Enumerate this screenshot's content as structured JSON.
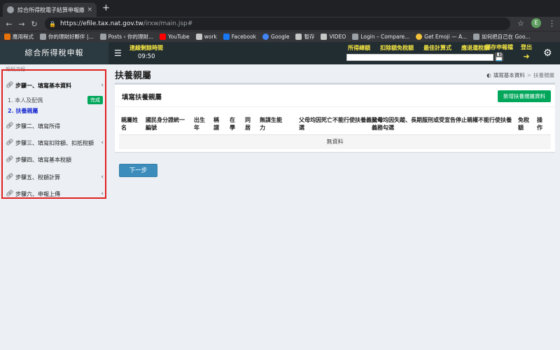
{
  "browser": {
    "tab_title": "綜合所得稅電子結算申報繳稅系",
    "tab_close": "×",
    "new_tab": "+",
    "url_host": "https://efile.tax.nat.gov.tw",
    "url_path": "/irxw/main.jsp#",
    "profile_initial": "E",
    "bookmarks": [
      {
        "label": "應用程式",
        "icon": "grid-icon"
      },
      {
        "label": "你的理財好夥伴 |...",
        "icon": "plane-icon"
      },
      {
        "label": "Posts ‹ 你的理財...",
        "icon": "page-icon"
      },
      {
        "label": "YouTube",
        "icon": "youtube-icon"
      },
      {
        "label": "work",
        "icon": "folder-icon"
      },
      {
        "label": "Facebook",
        "icon": "facebook-icon"
      },
      {
        "label": "Google",
        "icon": "google-icon"
      },
      {
        "label": "暫存",
        "icon": "folder-icon"
      },
      {
        "label": "VIDEO",
        "icon": "folder-icon"
      },
      {
        "label": "Login – Compare...",
        "icon": "page-icon"
      },
      {
        "label": "Get Emoji — A...",
        "icon": "emoji-icon"
      },
      {
        "label": "如何把自己在 Goo...",
        "icon": "send-icon"
      }
    ]
  },
  "header": {
    "app_name": "綜合所得稅申報",
    "timer_label": "連線剩餘時間",
    "timer_value": "09:50",
    "links": [
      "所得總額",
      "扣除額免稅額",
      "最佳計算式",
      "應退還稅額"
    ],
    "save_label": "儲存申報檔",
    "logout_label": "登出"
  },
  "sidebar": {
    "section_label": "報稅流程",
    "steps": [
      {
        "label": "步驟一、填寫基本資料",
        "chevron": "‹"
      },
      {
        "label": "步驟二、填寫所得",
        "chevron": ""
      },
      {
        "label": "步驟三、填寫扣除額、扣抵稅額",
        "chevron": "‹"
      },
      {
        "label": "步驟四、填寫基本稅額",
        "chevron": ""
      },
      {
        "label": "步驟五、稅額計算",
        "chevron": "‹"
      },
      {
        "label": "步驟六、申報上傳",
        "chevron": "‹"
      }
    ],
    "substeps": [
      {
        "label": "1. 本人及配偶",
        "badge": "完成"
      },
      {
        "label": "2. 扶養親屬",
        "badge": ""
      }
    ]
  },
  "main": {
    "page_title": "扶養親屬",
    "breadcrumb": {
      "home": "填寫基本資料",
      "separator": ">",
      "current": "扶養親屬"
    },
    "box_title": "填寫扶養親屬",
    "add_button": "新增扶養親屬資料",
    "table_headers": [
      "親屬姓名",
      "國民身分證統一編號",
      "出生年",
      "稱謂",
      "在學",
      "同居",
      "無謀生能力",
      "父母均因死亡不能行使扶養義務勾選",
      "父母均因失蹤、長期服刑或受宣告停止親權不能行使扶養義務勾選",
      "免稅額",
      "操作"
    ],
    "empty_text": "無資料",
    "next_button": "下一步"
  },
  "colors": {
    "header_bg": "#222d32",
    "highlight_yellow": "#f5e642",
    "success_green": "#00a65a",
    "primary_blue": "#3c8dbc",
    "annotation_red": "#e02020"
  }
}
